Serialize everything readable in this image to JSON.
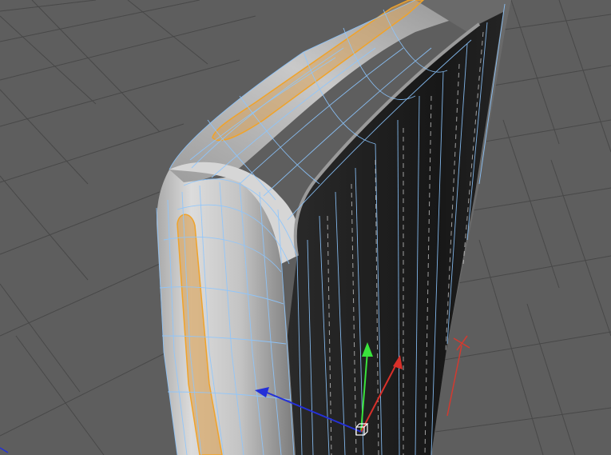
{
  "viewport": {
    "grid_visible": true,
    "background_color": "#5e5e5e",
    "grid_color": "#484848"
  },
  "model": {
    "body_color": "#bdbdbd",
    "screen_color": "#1b1b1b",
    "wireframe_color": "#8cc6ff",
    "selection_color": "#f0a32a"
  },
  "gizmo": {
    "axis_y_color": "#39e33c",
    "axis_x_color": "#d9302a",
    "axis_z_color": "#2430d8",
    "handle_icon": "cube-handle-icon",
    "null_marker_icon": "null-x-icon"
  }
}
